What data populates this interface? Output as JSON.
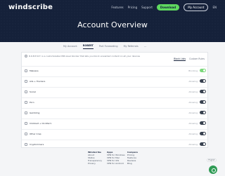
{
  "header": {
    "logo": "windscribe",
    "nav": [
      "Features",
      "Pricing",
      "Support"
    ],
    "download_label": "Download",
    "account_label": "My Account",
    "language": "EN",
    "title": "Account Overview"
  },
  "tabs": [
    {
      "label": "My Account",
      "active": false
    },
    {
      "label": "ROBERT",
      "active": true
    },
    {
      "label": "Port Forwarding",
      "active": false
    },
    {
      "label": "My Referrals",
      "active": false
    }
  ],
  "more_label": "...",
  "panel": {
    "intro": "R.O.B.E.R.T. is a customizable DNS level blocker that lets you block unwanted content on all your devices",
    "modes": [
      "Block Lists",
      "Custom Rules"
    ],
    "rows": [
      {
        "label": "Malware",
        "status": "Blocking",
        "on": true
      },
      {
        "label": "Ads + Trackers",
        "status": "Allowing",
        "on": false
      },
      {
        "label": "Social",
        "status": "Allowing",
        "on": false
      },
      {
        "label": "Porn",
        "status": "Allowing",
        "on": false
      },
      {
        "label": "Gambling",
        "status": "Allowing",
        "on": false
      },
      {
        "label": "Clickbait + Clickfarm",
        "status": "Allowing",
        "on": false
      },
      {
        "label": "Other Crap",
        "status": "Allowing",
        "on": false
      },
      {
        "label": "Cryptominers",
        "status": "Allowing",
        "on": false
      }
    ]
  },
  "footer": {
    "columns": [
      {
        "title": "Windscribe",
        "links": [
          "About",
          "Status",
          "Transparency",
          "Privacy"
        ]
      },
      {
        "title": "Apps",
        "links": [
          "VPN for Windows",
          "VPN for Mac",
          "VPN for iOS",
          "VPN for Android"
        ]
      },
      {
        "title": "Compare",
        "links": [
          "Pricing",
          "Features",
          "Reviews",
          "Blog"
        ]
      }
    ],
    "language_select": "English"
  },
  "colors": {
    "navy": "#15213a",
    "accent_green": "#5fd95f",
    "toggle_on": "#7bd87b"
  }
}
